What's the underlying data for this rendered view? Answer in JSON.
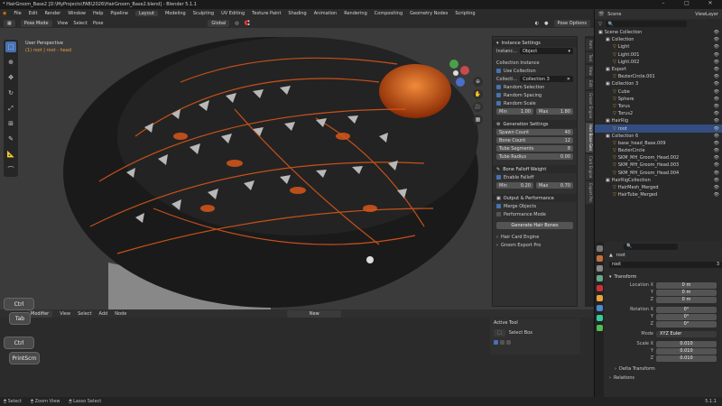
{
  "window": {
    "title": "* HairGroom_Base2 [D:\\MyProjects\\FAB\\2026\\HairGroom_Base2.blend] - Blender 5.1.1"
  },
  "menu": [
    "File",
    "Edit",
    "Render",
    "Window",
    "Help",
    "Pipeline"
  ],
  "workspaces": [
    "Layout",
    "Modeling",
    "Sculpting",
    "UV Editing",
    "Texture Paint",
    "Shading",
    "Animation",
    "Rendering",
    "Compositing",
    "Geometry Nodes",
    "Scripting"
  ],
  "header": {
    "mode": "Pose Mode",
    "items": [
      "View",
      "Select",
      "Pose"
    ],
    "orientation": "Global",
    "options": "Pose Options"
  },
  "viewport": {
    "label": "User Perspective",
    "sublabel": "(1) root | root - head"
  },
  "npanel": {
    "instance_settings": "Instance Settings",
    "instance_label": "Instanc...",
    "instance_value": "Object",
    "collection_instance": "Collection Instance",
    "use_collection": "Use Collection",
    "collection_label": "Collecti...",
    "collection_value": "Collection 3",
    "random_selection": "Random Selection",
    "random_spacing": "Random Spacing",
    "random_scale": "Random Scale",
    "scale_min_label": "Min",
    "scale_min": "1.00",
    "scale_max_label": "Max",
    "scale_max": "1.80",
    "generation_settings": "Generation Settings",
    "spawn_count_label": "Spawn Count",
    "spawn_count": "40",
    "bone_count_label": "Bone Count",
    "bone_count": "12",
    "tube_segments_label": "Tube Segments",
    "tube_segments": "8",
    "tube_radius_label": "Tube Radius",
    "tube_radius": "0.00",
    "bone_falloff_weight": "Bone Falloff Weight",
    "enable_falloff": "Enable Falloff",
    "falloff_min_label": "Min",
    "falloff_min": "0.20",
    "falloff_max_label": "Max",
    "falloff_max": "0.70",
    "output_performance": "Output & Performance",
    "merge_objects": "Merge Objects",
    "performance_mode": "Performance Mode",
    "generate_button": "Generate Hair Bones",
    "hair_card_engine": "Hair Card Engine",
    "groom_export_pro": "Groom Export Pro"
  },
  "vtabs": [
    "Item",
    "Tool",
    "View",
    "Edit",
    "Groom Engine",
    "Hair Bone Gen",
    "Card Engine",
    "Export Pro",
    "Animation",
    "BBTools"
  ],
  "bottom": {
    "editor": "Modifier",
    "items": [
      "View",
      "Select",
      "Add",
      "Node"
    ],
    "new_label": "New",
    "active_tool": "Active Tool",
    "select_box": "Select Box"
  },
  "keys": [
    "Ctrl",
    "Tab",
    "Ctrl",
    "PrintScrn"
  ],
  "outliner": {
    "scene": "Scene",
    "view_layer": "ViewLayer",
    "search_placeholder": "",
    "rows": [
      {
        "name": "Scene Collection",
        "level": 0
      },
      {
        "name": "Collection",
        "level": 1
      },
      {
        "name": "Light",
        "level": 2
      },
      {
        "name": "Light.001",
        "level": 2
      },
      {
        "name": "Light.002",
        "level": 2
      },
      {
        "name": "Export",
        "level": 1
      },
      {
        "name": "BezierCircle.001",
        "level": 2
      },
      {
        "name": "Collection 3",
        "level": 1
      },
      {
        "name": "Cube",
        "level": 2
      },
      {
        "name": "Sphere",
        "level": 2
      },
      {
        "name": "Torus",
        "level": 2
      },
      {
        "name": "Torus2",
        "level": 2
      },
      {
        "name": "HairRig",
        "level": 1
      },
      {
        "name": "root",
        "level": 2,
        "selected": true
      },
      {
        "name": "Collection 6",
        "level": 1
      },
      {
        "name": "base_head_Base.009",
        "level": 2
      },
      {
        "name": "BezierCircle",
        "level": 2
      },
      {
        "name": "SKM_MH_Groom_Head.002",
        "level": 2
      },
      {
        "name": "SKM_MH_Groom_Head.003",
        "level": 2
      },
      {
        "name": "SKM_MH_Groom_Head.004",
        "level": 2
      },
      {
        "name": "HairRigCollection",
        "level": 1
      },
      {
        "name": "HairMesh_Merged",
        "level": 2
      },
      {
        "name": "HairTube_Merged",
        "level": 2
      }
    ]
  },
  "properties": {
    "object_name": "root",
    "data_name": "root",
    "users": "3",
    "transform": "Transform",
    "location_x_label": "Location X",
    "location_x": "0 m",
    "location_y": "0 m",
    "location_z": "0 m",
    "rotation_x_label": "Rotation X",
    "rotation_x": "0°",
    "rotation_y": "0°",
    "rotation_z": "0°",
    "mode_label": "Mode",
    "mode": "XYZ Euler",
    "scale_x_label": "Scale X",
    "scale_x": "0.010",
    "scale_y": "0.010",
    "scale_z": "0.010",
    "y_label": "Y",
    "z_label": "Z",
    "delta_transform": "Delta Transform",
    "relations": "Relations"
  },
  "status": {
    "select": "Select",
    "zoom_view": "Zoom View",
    "lasso_select": "Lasso Select",
    "version": "5.1.1"
  },
  "colors": {
    "accent": "#4772b3",
    "viewport_bg": "#3b3b3b",
    "hair_orange": "#d7561a"
  }
}
